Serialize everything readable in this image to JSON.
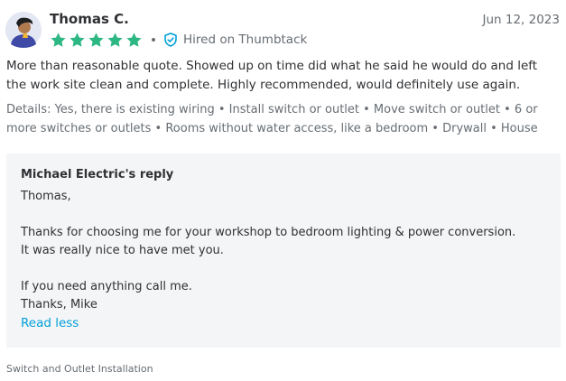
{
  "review": {
    "reviewer_name": "Thomas C.",
    "date": "Jun 12, 2023",
    "rating": 5,
    "star_color": "#2db783",
    "hired_badge": "Hired on Thumbtack",
    "hired_icon": "shield-check-icon",
    "text": "More than reasonable quote. Showed up on time did what he said he would do and left the work site clean and complete. Highly recommended, would definitely use again.",
    "details": "Details: Yes, there is existing wiring • Install switch or outlet • Move switch or outlet • 6 or more switches or outlets • Rooms without water access, like a bedroom • Drywall • House"
  },
  "reply": {
    "title": "Michael Electric's reply",
    "lines": [
      "Thomas,",
      "Thanks for choosing me for your workshop to bedroom lighting & power conversion.",
      "It was really nice to have met you.",
      "If you need anything call me.",
      "Thanks, Mike"
    ],
    "toggle_label": "Read less",
    "link_color": "#009fd9"
  },
  "service": "Switch and Outlet Installation"
}
